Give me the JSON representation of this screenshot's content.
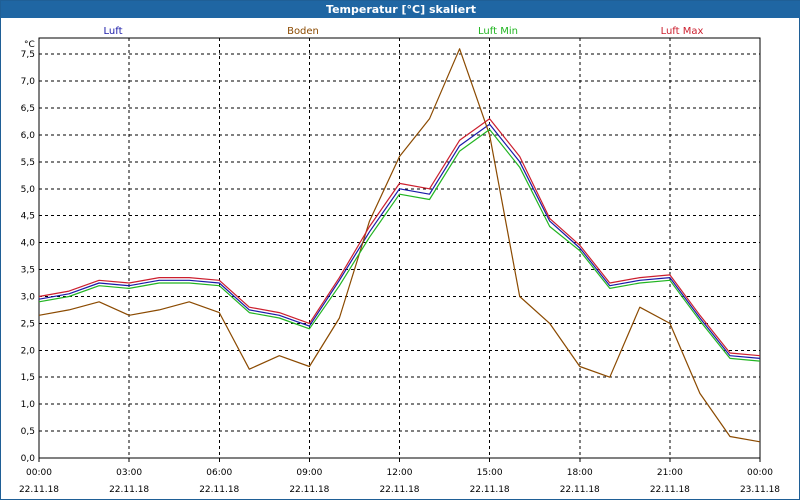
{
  "window": {
    "title": "Temperatur [°C] skaliert"
  },
  "chart_data": {
    "type": "line",
    "title": "Temperatur [°C] skaliert",
    "ylabel": "°C",
    "ylim": [
      0.0,
      7.8
    ],
    "y_ticks": [
      "0,0",
      "0,5",
      "1,0",
      "1,5",
      "2,0",
      "2,5",
      "3,0",
      "3,5",
      "4,0",
      "4,5",
      "5,0",
      "5,5",
      "6,0",
      "6,5",
      "7,0",
      "7,5"
    ],
    "x_ticks": [
      {
        "time": "00:00",
        "date": "22.11.18"
      },
      {
        "time": "03:00",
        "date": "22.11.18"
      },
      {
        "time": "06:00",
        "date": "22.11.18"
      },
      {
        "time": "09:00",
        "date": "22.11.18"
      },
      {
        "time": "12:00",
        "date": "22.11.18"
      },
      {
        "time": "15:00",
        "date": "22.11.18"
      },
      {
        "time": "18:00",
        "date": "22.11.18"
      },
      {
        "time": "21:00",
        "date": "22.11.18"
      },
      {
        "time": "00:00",
        "date": "23.11.18"
      }
    ],
    "x_hours": [
      0,
      1,
      2,
      3,
      4,
      5,
      6,
      7,
      8,
      9,
      10,
      11,
      12,
      13,
      14,
      15,
      16,
      17,
      18,
      19,
      20,
      21,
      22,
      23,
      24
    ],
    "grid": true,
    "legend_position": "top",
    "series": [
      {
        "name": "Luft",
        "color": "#1a1aa8",
        "values": [
          2.95,
          3.05,
          3.25,
          3.2,
          3.3,
          3.3,
          3.25,
          2.75,
          2.65,
          2.45,
          3.3,
          4.2,
          5.0,
          4.9,
          5.8,
          6.2,
          5.5,
          4.4,
          3.9,
          3.2,
          3.3,
          3.35,
          2.6,
          1.9,
          1.85
        ]
      },
      {
        "name": "Boden",
        "color": "#8b4a00",
        "values": [
          2.65,
          2.75,
          2.9,
          2.65,
          2.75,
          2.9,
          2.7,
          1.65,
          1.9,
          1.7,
          2.6,
          4.4,
          5.6,
          6.3,
          7.6,
          6.0,
          3.0,
          2.5,
          1.7,
          1.5,
          2.8,
          2.5,
          1.2,
          0.4,
          0.3
        ]
      },
      {
        "name": "Luft Min",
        "color": "#22b522",
        "values": [
          2.9,
          3.0,
          3.2,
          3.15,
          3.25,
          3.25,
          3.2,
          2.7,
          2.6,
          2.4,
          3.2,
          4.1,
          4.9,
          4.8,
          5.7,
          6.1,
          5.4,
          4.3,
          3.85,
          3.15,
          3.25,
          3.3,
          2.55,
          1.85,
          1.8
        ]
      },
      {
        "name": "Luft Max",
        "color": "#cc1f2e",
        "values": [
          3.0,
          3.1,
          3.3,
          3.25,
          3.35,
          3.35,
          3.3,
          2.8,
          2.7,
          2.5,
          3.35,
          4.3,
          5.1,
          5.0,
          5.9,
          6.3,
          5.6,
          4.45,
          3.95,
          3.25,
          3.35,
          3.4,
          2.65,
          1.95,
          1.9
        ]
      }
    ]
  }
}
